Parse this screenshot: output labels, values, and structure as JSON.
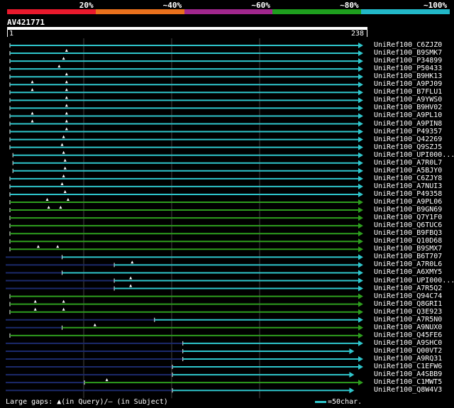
{
  "legend": [
    {
      "label": "20%",
      "color": "#e8192c"
    },
    {
      "label": "~40%",
      "color": "#e8701c"
    },
    {
      "label": "~60%",
      "color": "#a0268c"
    },
    {
      "label": "~80%",
      "color": "#1e9e1e"
    },
    {
      "label": "~100%",
      "color": "#22b8c8"
    }
  ],
  "query": {
    "name": "AV421771",
    "start": "1",
    "end": "238"
  },
  "hits": [
    {
      "name": "UniRef100_C6ZJZ0",
      "color": "cyan",
      "start": 1,
      "end": 238,
      "marks": []
    },
    {
      "name": "UniRef100_B9SMK7",
      "color": "cyan",
      "start": 1,
      "end": 238,
      "marks": [
        39
      ]
    },
    {
      "name": "UniRef100_P34899",
      "color": "cyan",
      "start": 1,
      "end": 238,
      "marks": [
        37
      ]
    },
    {
      "name": "UniRef100_P50433",
      "color": "cyan",
      "start": 1,
      "end": 238,
      "marks": [
        34
      ]
    },
    {
      "name": "UniRef100_B9HK13",
      "color": "cyan",
      "start": 1,
      "end": 238,
      "marks": [
        39
      ]
    },
    {
      "name": "UniRef100_A9PJ09",
      "color": "cyan",
      "start": 1,
      "end": 238,
      "marks": [
        16,
        39
      ]
    },
    {
      "name": "UniRef100_B7FLU1",
      "color": "cyan",
      "start": 1,
      "end": 238,
      "marks": [
        16,
        39
      ]
    },
    {
      "name": "UniRef100_A9YWS0",
      "color": "cyan",
      "start": 1,
      "end": 238,
      "marks": [
        39
      ]
    },
    {
      "name": "UniRef100_B9HV02",
      "color": "cyan",
      "start": 1,
      "end": 238,
      "marks": [
        39
      ]
    },
    {
      "name": "UniRef100_A9PL10",
      "color": "cyan",
      "start": 1,
      "end": 238,
      "marks": [
        16,
        39
      ]
    },
    {
      "name": "UniRef100_A9PIN8",
      "color": "cyan",
      "start": 1,
      "end": 238,
      "marks": [
        16,
        39
      ]
    },
    {
      "name": "UniRef100_P49357",
      "color": "cyan",
      "start": 1,
      "end": 238,
      "marks": [
        39
      ]
    },
    {
      "name": "UniRef100_Q42269",
      "color": "cyan",
      "start": 1,
      "end": 238,
      "marks": [
        37
      ]
    },
    {
      "name": "UniRef100_Q9SZJ5",
      "color": "cyan",
      "start": 1,
      "end": 238,
      "marks": [
        36
      ]
    },
    {
      "name": "UniRef100_UPI000...",
      "color": "cyan",
      "start": 3,
      "end": 238,
      "marks": [
        37
      ]
    },
    {
      "name": "UniRef100_A7R0L7",
      "color": "cyan",
      "start": 3,
      "end": 238,
      "marks": [
        38
      ]
    },
    {
      "name": "UniRef100_A5BJY0",
      "color": "cyan",
      "start": 3,
      "end": 238,
      "marks": [
        38
      ]
    },
    {
      "name": "UniRef100_C6ZJY8",
      "color": "cyan",
      "start": 1,
      "end": 238,
      "marks": [
        37
      ]
    },
    {
      "name": "UniRef100_A7NUI3",
      "color": "cyan",
      "start": 1,
      "end": 238,
      "marks": [
        36
      ]
    },
    {
      "name": "UniRef100_P49358",
      "color": "cyan",
      "start": 1,
      "end": 238,
      "marks": [
        38
      ]
    },
    {
      "name": "UniRef100_A9PL06",
      "color": "green",
      "start": 1,
      "end": 238,
      "marks": [
        26,
        40
      ]
    },
    {
      "name": "UniRef100_B9GN69",
      "color": "green",
      "start": 1,
      "end": 238,
      "marks": [
        27,
        35
      ]
    },
    {
      "name": "UniRef100_Q7Y1F0",
      "color": "green",
      "start": 1,
      "end": 238,
      "marks": []
    },
    {
      "name": "UniRef100_Q6TUC6",
      "color": "green",
      "start": 1,
      "end": 238,
      "marks": []
    },
    {
      "name": "UniRef100_B9FBQ3",
      "color": "green",
      "start": 1,
      "end": 238,
      "marks": []
    },
    {
      "name": "UniRef100_Q10D68",
      "color": "green",
      "start": 1,
      "end": 238,
      "marks": []
    },
    {
      "name": "UniRef100_B9SMX7",
      "color": "green",
      "start": 1,
      "end": 238,
      "marks": [
        20,
        33
      ]
    },
    {
      "name": "UniRef100_B6T707",
      "color": "cyan",
      "start": 36,
      "end": 238,
      "marks": []
    },
    {
      "name": "UniRef100_A7R0L6",
      "color": "cyan",
      "start": 71,
      "end": 238,
      "marks": [
        83
      ]
    },
    {
      "name": "UniRef100_A6XMY5",
      "color": "cyan",
      "start": 36,
      "end": 238,
      "marks": []
    },
    {
      "name": "UniRef100_UPI000...",
      "color": "cyan",
      "start": 71,
      "end": 238,
      "marks": [
        82
      ]
    },
    {
      "name": "UniRef100_A7R5Q2",
      "color": "cyan",
      "start": 71,
      "end": 238,
      "marks": [
        82
      ]
    },
    {
      "name": "UniRef100_Q94C74",
      "color": "green",
      "start": 1,
      "end": 238,
      "marks": []
    },
    {
      "name": "UniRef100_Q8GRI1",
      "color": "green",
      "start": 1,
      "end": 238,
      "marks": [
        18,
        37
      ]
    },
    {
      "name": "UniRef100_Q3E923",
      "color": "green",
      "start": 1,
      "end": 238,
      "marks": [
        18,
        37
      ]
    },
    {
      "name": "UniRef100_A7R5N0",
      "color": "cyan",
      "start": 98,
      "end": 238,
      "marks": []
    },
    {
      "name": "UniRef100_A9NUX0",
      "color": "green",
      "start": 36,
      "end": 238,
      "marks": [
        58
      ]
    },
    {
      "name": "UniRef100_Q45FE6",
      "color": "green",
      "start": 1,
      "end": 238,
      "marks": []
    },
    {
      "name": "UniRef100_A9SHC0",
      "color": "cyan",
      "start": 117,
      "end": 238,
      "marks": []
    },
    {
      "name": "UniRef100_Q00VT2",
      "color": "cyan",
      "start": 117,
      "end": 232,
      "marks": []
    },
    {
      "name": "UniRef100_A9RQ31",
      "color": "cyan",
      "start": 117,
      "end": 238,
      "marks": []
    },
    {
      "name": "UniRef100_C1EFW6",
      "color": "cyan",
      "start": 110,
      "end": 238,
      "marks": []
    },
    {
      "name": "UniRef100_A4SBB9",
      "color": "cyan",
      "start": 110,
      "end": 232,
      "marks": []
    },
    {
      "name": "UniRef100_C1MWT5",
      "color": "green",
      "start": 51,
      "end": 238,
      "marks": [
        66
      ]
    },
    {
      "name": "UniRef100_Q8W4V3",
      "color": "cyan",
      "start": 110,
      "end": 232,
      "marks": []
    }
  ],
  "colors": {
    "cyan": "#2fc6cc",
    "green": "#2e9e1e",
    "grid": "#444",
    "navy": "#1b2a6b"
  },
  "footer": {
    "gaps_label": "Large gaps: ▲(in Query)/– (in Subject)",
    "scale_label": "=50char."
  }
}
